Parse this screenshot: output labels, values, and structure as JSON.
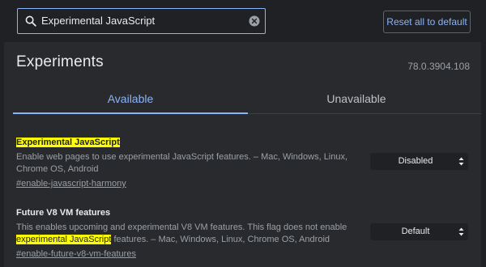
{
  "search": {
    "value": "Experimental JavaScript",
    "icon": "search-icon",
    "clear_icon": "clear-icon"
  },
  "toolbar": {
    "reset_label": "Reset all to default"
  },
  "header": {
    "title": "Experiments",
    "version": "78.0.3904.108"
  },
  "tabs": [
    {
      "label": "Available",
      "selected": true
    },
    {
      "label": "Unavailable",
      "selected": false
    }
  ],
  "flags": [
    {
      "name_highlight": "Experimental JavaScript",
      "description": "Enable web pages to use experimental JavaScript features. – Mac, Windows, Linux, Chrome OS, Android",
      "link": "#enable-javascript-harmony",
      "select_value": "Disabled"
    },
    {
      "name": "Future V8 VM features",
      "description_before": "This enables upcoming and experimental V8 VM features. This flag does not enable ",
      "description_highlight": "experimental JavaScript",
      "description_after": " features. – Mac, Windows, Linux, Chrome OS, Android",
      "link": "#enable-future-v8-vm-features",
      "select_value": "Default"
    }
  ],
  "colors": {
    "accent": "#8ab4f8",
    "background": "#202124",
    "panel": "#292a2d",
    "highlight": "#ffff00"
  }
}
